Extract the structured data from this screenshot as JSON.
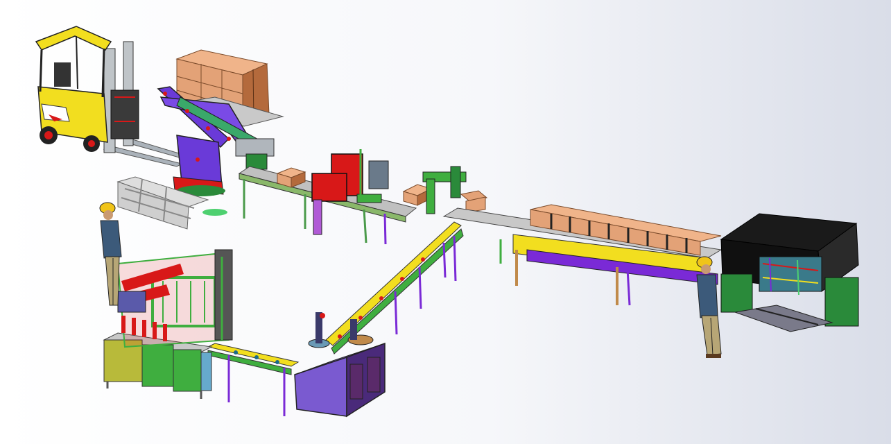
{
  "scene": {
    "description_label": "",
    "colors": {
      "background_light": "#ffffff",
      "background_shade": "#d7dbe6",
      "frame_green": "#3fae3f",
      "frame_purple": "#7a2ad6",
      "box_cardboard": "#e3a277",
      "forklift_yellow": "#f2de1f",
      "robot_purple": "#6a3ad8",
      "machine_red": "#d81818",
      "machine_black": "#101010",
      "roller_gray": "#b9b9b9",
      "worker_blue": "#3c5a7a",
      "worker_khaki": "#b7a676",
      "helmet_yellow": "#f0c419"
    },
    "objects": [
      "forklift",
      "palletizing-robot",
      "stacked-pallet-boxes",
      "case-sealer",
      "roller-conveyor",
      "box-accumulation-conveyor",
      "carton-erector",
      "filling-machine",
      "capping-machine",
      "bottle-conveyor",
      "worker-left",
      "worker-right"
    ]
  }
}
